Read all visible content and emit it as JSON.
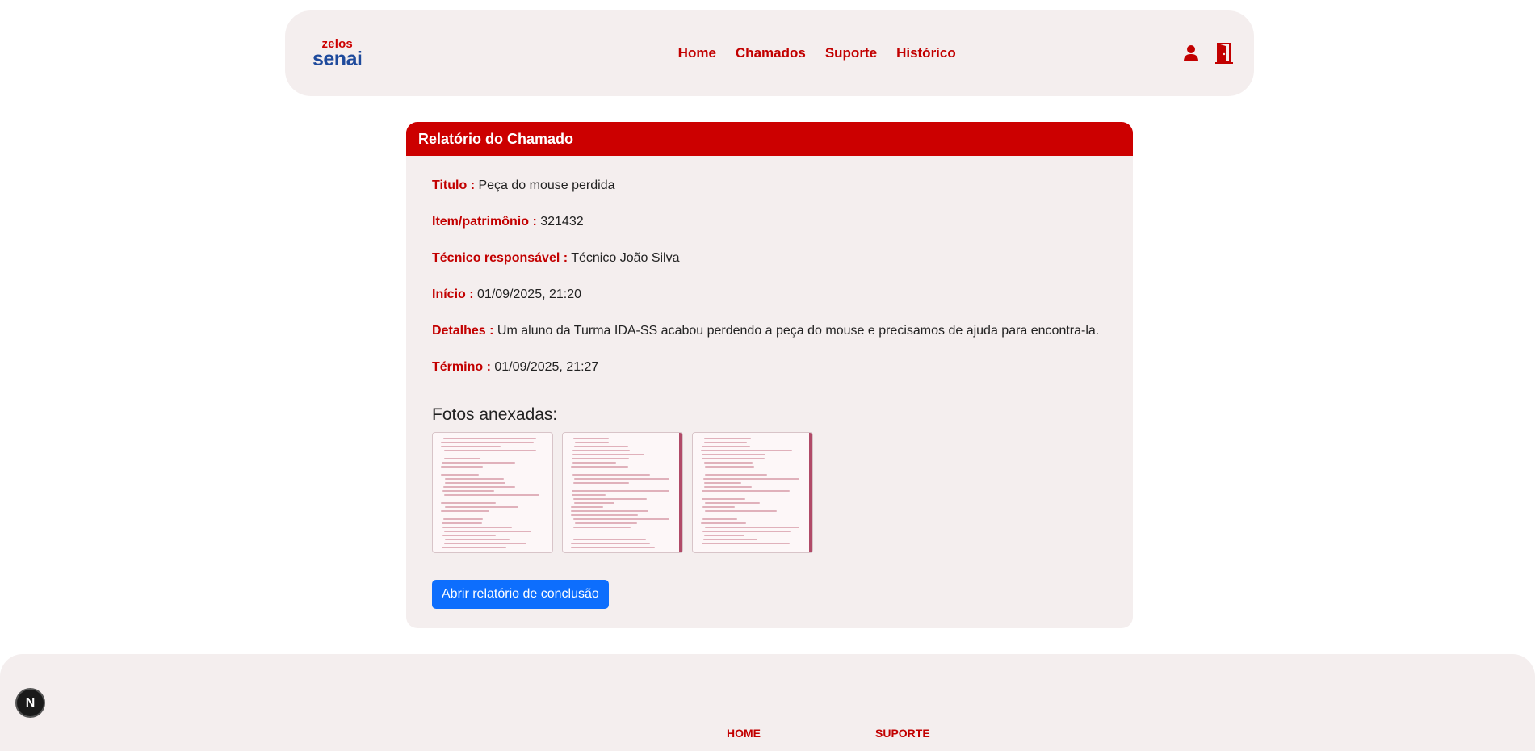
{
  "brand": {
    "top": "zelos",
    "bottom": "senai"
  },
  "nav": {
    "links": [
      "Home",
      "Chamados",
      "Suporte",
      "Histórico"
    ],
    "icons": [
      "user-icon",
      "logout-door-icon"
    ]
  },
  "report": {
    "header": "Relatório do Chamado",
    "fields": [
      {
        "label": "Titulo :",
        "value": "Peça do mouse perdida"
      },
      {
        "label": "Item/patrimônio :",
        "value": "321432"
      },
      {
        "label": "Técnico responsável :",
        "value": "Técnico João Silva"
      },
      {
        "label": "Início :",
        "value": "01/09/2025, 21:20"
      },
      {
        "label": "Detalhes :",
        "value": "Um aluno da Turma IDA-SS acabou perdendo a peça do mouse e precisamos de ajuda para encontra-la."
      },
      {
        "label": "Término :",
        "value": "01/09/2025, 21:27"
      }
    ],
    "photos_title": "Fotos anexadas:",
    "photo_count": 3,
    "button_label": "Abrir relatório de conclusão"
  },
  "footer": {
    "col1": "HOME",
    "col2": "SUPORTE"
  },
  "dev_badge": "N",
  "colors": {
    "accent": "#cc0000",
    "brand_blue": "#1e4a9c",
    "panel": "#f4eeee",
    "button": "#0d6efd"
  }
}
